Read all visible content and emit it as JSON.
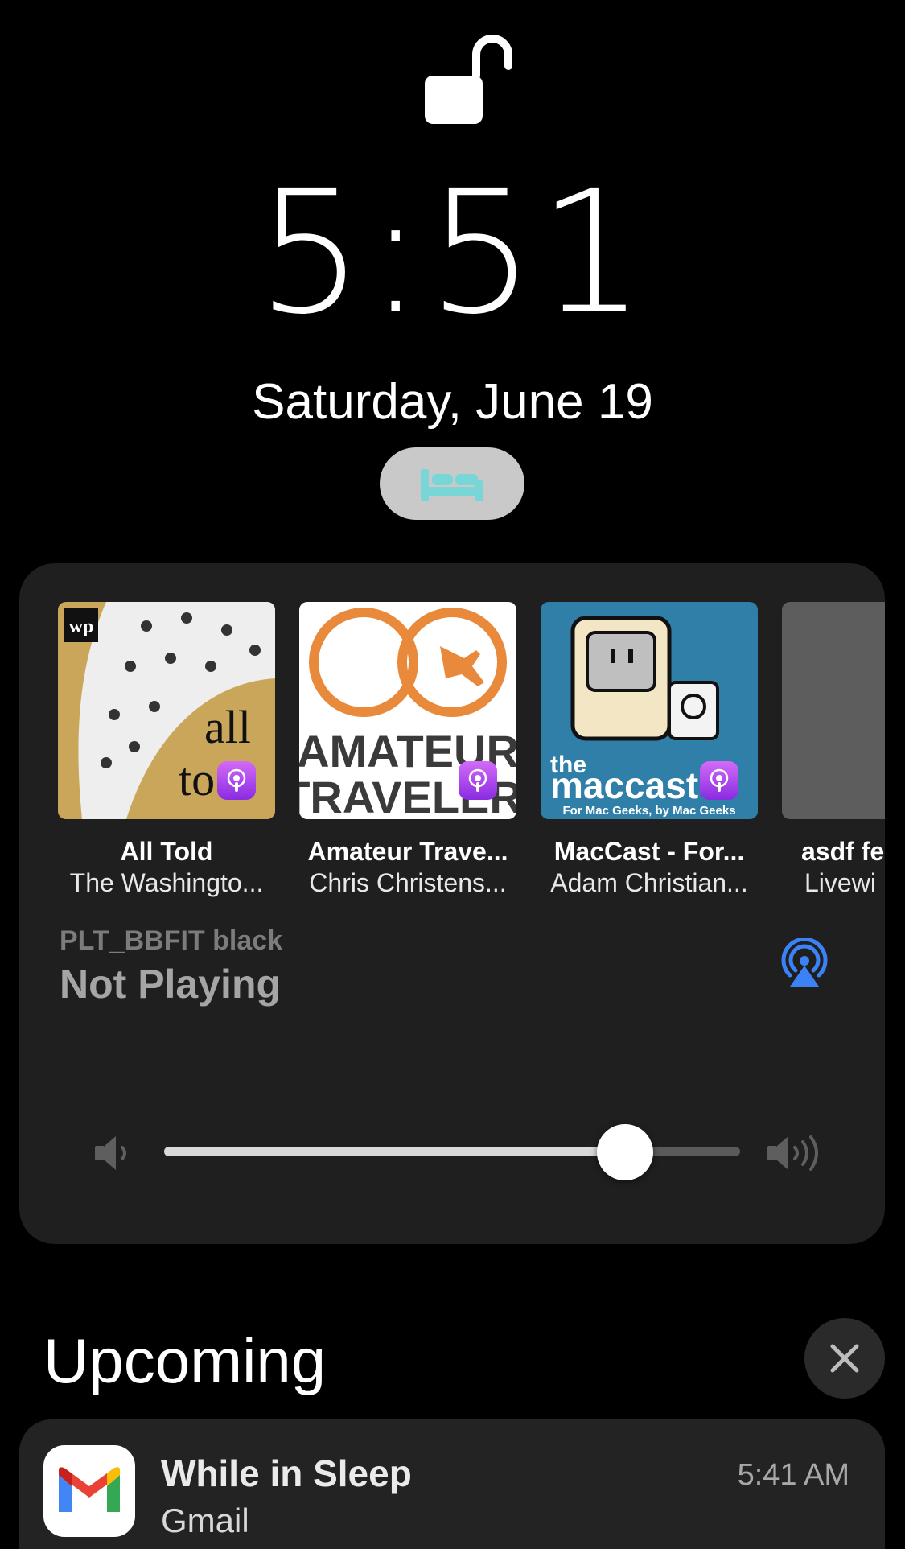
{
  "lock": {
    "icon": "unlocked-padlock-icon"
  },
  "clock": {
    "time": "5:51",
    "date": "Saturday, June 19"
  },
  "sleep_mode": {
    "icon": "bed-icon",
    "color": "#78d6d6"
  },
  "now_playing": {
    "podcasts": [
      {
        "title": "All Told",
        "subtitle": "The Washingto...",
        "art_text_top": "all",
        "art_text_bottom": "to",
        "brand_mark": "wp"
      },
      {
        "title": "Amateur Trave...",
        "subtitle": "Chris Christens...",
        "art_text_top": "AMATEUR",
        "art_text_bottom": "TRAVELER"
      },
      {
        "title": "MacCast - For...",
        "subtitle": "Adam Christian...",
        "art_text_top": "the",
        "art_text_bottom": "maccast",
        "art_tagline": "For Mac Geeks, by Mac Geeks"
      },
      {
        "title": "asdf fe",
        "subtitle": "Livewi"
      }
    ],
    "device": "PLT_BBFIT black",
    "status": "Not Playing",
    "airplay_icon": "airplay-audio-icon",
    "volume": 0.8,
    "accent_color": "#3b82f6"
  },
  "upcoming": {
    "heading": "Upcoming",
    "close_icon": "close-icon",
    "notification": {
      "title": "While in Sleep",
      "app": "Gmail",
      "time": "5:41 AM",
      "icon": "gmail-icon"
    }
  }
}
